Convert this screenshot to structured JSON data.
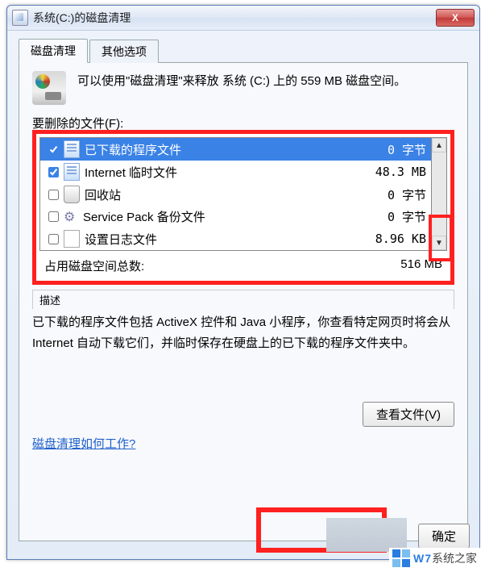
{
  "titlebar": {
    "title": "系统(C:)的磁盘清理",
    "close": "X"
  },
  "tabs": {
    "cleanup": "磁盘清理",
    "other": "其他选项"
  },
  "info_text": "可以使用\"磁盘清理\"来释放 系统 (C:) 上的 559 MB 磁盘空间。",
  "delete_label": "要删除的文件(F):",
  "files": [
    {
      "name": "已下载的程序文件",
      "size": "0 字节",
      "selected": true,
      "checked": true,
      "icon": "doc"
    },
    {
      "name": "Internet 临时文件",
      "size": "48.3 MB",
      "selected": false,
      "checked": true,
      "icon": "doc"
    },
    {
      "name": "回收站",
      "size": "0 字节",
      "selected": false,
      "checked": false,
      "icon": "bin"
    },
    {
      "name": "Service Pack 备份文件",
      "size": "0 字节",
      "selected": false,
      "checked": false,
      "icon": "gear"
    },
    {
      "name": "设置日志文件",
      "size": "8.96 KB",
      "selected": false,
      "checked": false,
      "icon": "plain"
    }
  ],
  "total": {
    "label": "占用磁盘空间总数:",
    "value": "516 MB"
  },
  "description": {
    "label": "描述",
    "text": "已下载的程序文件包括 ActiveX 控件和 Java 小程序，你查看特定网页时将会从 Internet 自动下载它们，并临时保存在硬盘上的已下载的程序文件夹中。"
  },
  "buttons": {
    "view": "查看文件(V)",
    "ok": "确定",
    "link": "磁盘清理如何工作?"
  },
  "watermark": {
    "brand": "W7",
    "text": "系统之家"
  },
  "colors": {
    "highlight_red": "#ff2020",
    "selection_blue": "#3a82e6"
  }
}
